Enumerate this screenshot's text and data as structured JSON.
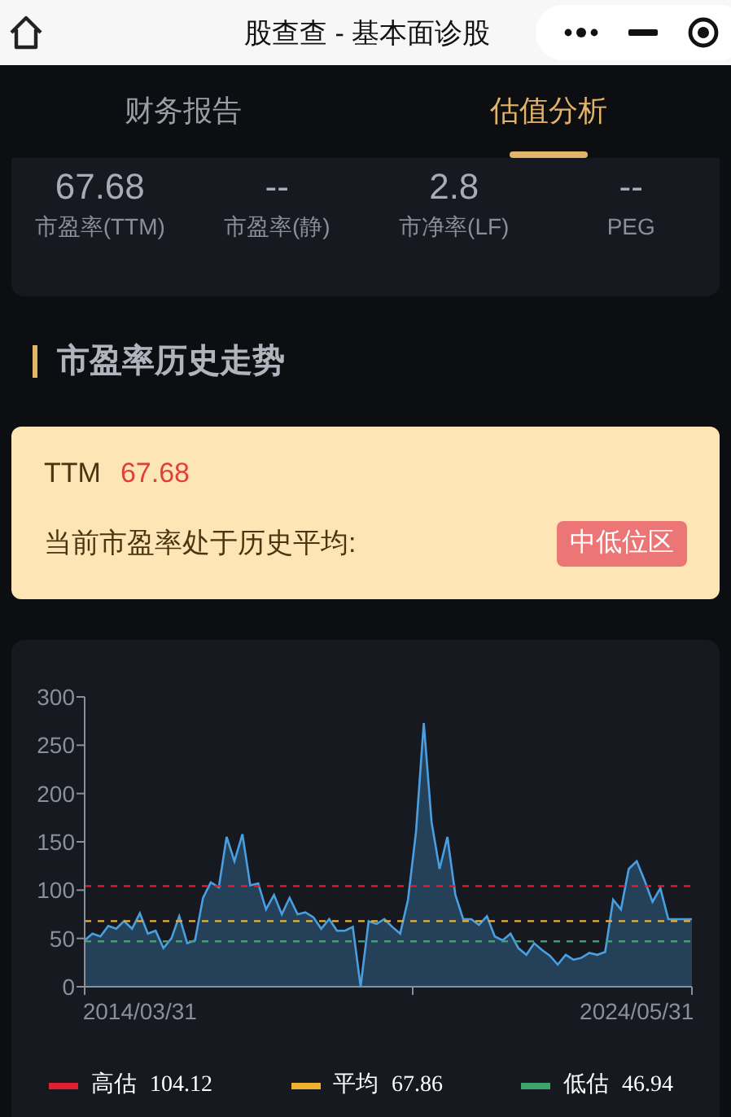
{
  "window": {
    "title": "股查查 - 基本面诊股"
  },
  "tabs": [
    {
      "label": "财务报告",
      "selected": false
    },
    {
      "label": "估值分析",
      "selected": true
    }
  ],
  "metrics": [
    {
      "value": "67.68",
      "label": "市盈率(TTM)"
    },
    {
      "value": "--",
      "label": "市盈率(静)"
    },
    {
      "value": "2.8",
      "label": "市净率(LF)"
    },
    {
      "value": "--",
      "label": "PEG"
    }
  ],
  "section_title": "市盈率历史走势",
  "summary": {
    "label": "TTM",
    "value": "67.68",
    "text": "当前市盈率处于历史平均:",
    "badge": "中低位区"
  },
  "chart_data": {
    "type": "area",
    "ylim": [
      0,
      300
    ],
    "yticks": [
      0,
      50,
      100,
      150,
      200,
      250,
      300
    ],
    "categories": [
      null,
      null,
      null,
      null,
      null,
      null,
      null,
      "2014/03/31",
      null,
      null,
      null,
      null,
      null,
      null,
      null,
      null,
      null,
      null,
      null,
      null,
      null,
      null,
      null,
      null,
      null,
      null,
      null,
      null,
      null,
      null,
      null,
      null,
      null,
      null,
      null,
      null,
      null,
      null,
      null,
      null,
      null,
      null,
      null,
      null,
      null,
      null,
      null,
      null,
      null,
      null,
      null,
      null,
      null,
      null,
      null,
      null,
      null,
      null,
      null,
      null,
      null,
      null,
      null,
      null,
      null,
      null,
      null,
      null,
      null,
      null,
      "2024/05/31",
      null,
      null,
      null,
      null,
      null,
      null,
      null
    ],
    "series": [
      {
        "color": "#4a9fe0",
        "values": [
          48,
          55,
          52,
          63,
          60,
          68,
          60,
          76,
          55,
          58,
          40,
          50,
          73,
          45,
          48,
          92,
          108,
          103,
          155,
          130,
          158,
          105,
          107,
          80,
          95,
          75,
          92,
          75,
          77,
          72,
          60,
          70,
          58,
          58,
          62,
          0,
          68,
          65,
          70,
          62,
          55,
          90,
          160,
          273,
          170,
          122,
          155,
          95,
          70,
          70,
          64,
          73,
          52,
          48,
          55,
          40,
          33,
          45,
          38,
          32,
          23,
          33,
          28,
          30,
          35,
          33,
          36,
          90,
          80,
          122,
          130,
          110,
          88,
          102,
          70,
          70,
          70,
          70
        ]
      },
      {
        "name": "高估",
        "type": "line",
        "line_style": "dashed",
        "color": "#e0202e",
        "values": [
          104.12,
          104.12,
          104.12,
          104.12,
          104.12,
          104.12,
          104.12,
          104.12,
          104.12,
          104.12,
          104.12,
          104.12,
          104.12,
          104.12,
          104.12,
          104.12,
          104.12,
          104.12,
          104.12,
          104.12,
          104.12,
          104.12,
          104.12,
          104.12,
          104.12,
          104.12,
          104.12,
          104.12,
          104.12,
          104.12,
          104.12,
          104.12,
          104.12,
          104.12,
          104.12,
          104.12,
          104.12,
          104.12,
          104.12,
          104.12,
          104.12,
          104.12,
          104.12,
          104.12,
          104.12,
          104.12,
          104.12,
          104.12,
          104.12,
          104.12,
          104.12,
          104.12,
          104.12,
          104.12,
          104.12,
          104.12,
          104.12,
          104.12,
          104.12,
          104.12,
          104.12,
          104.12,
          104.12,
          104.12,
          104.12,
          104.12,
          104.12,
          104.12,
          104.12,
          104.12,
          104.12,
          104.12,
          104.12,
          104.12,
          104.12,
          104.12,
          104.12,
          104.12
        ]
      },
      {
        "name": "平均",
        "type": "line",
        "line_style": "dashed",
        "color": "#f0b030",
        "values": [
          67.86,
          67.86,
          67.86,
          67.86,
          67.86,
          67.86,
          67.86,
          67.86,
          67.86,
          67.86,
          67.86,
          67.86,
          67.86,
          67.86,
          67.86,
          67.86,
          67.86,
          67.86,
          67.86,
          67.86,
          67.86,
          67.86,
          67.86,
          67.86,
          67.86,
          67.86,
          67.86,
          67.86,
          67.86,
          67.86,
          67.86,
          67.86,
          67.86,
          67.86,
          67.86,
          67.86,
          67.86,
          67.86,
          67.86,
          67.86,
          67.86,
          67.86,
          67.86,
          67.86,
          67.86,
          67.86,
          67.86,
          67.86,
          67.86,
          67.86,
          67.86,
          67.86,
          67.86,
          67.86,
          67.86,
          67.86,
          67.86,
          67.86,
          67.86,
          67.86,
          67.86,
          67.86,
          67.86,
          67.86,
          67.86,
          67.86,
          67.86,
          67.86,
          67.86,
          67.86,
          67.86,
          67.86,
          67.86,
          67.86,
          67.86,
          67.86,
          67.86,
          67.86
        ]
      },
      {
        "name": "低估",
        "type": "line",
        "line_style": "dashed",
        "color": "#3aa46a",
        "values": [
          46.94,
          46.94,
          46.94,
          46.94,
          46.94,
          46.94,
          46.94,
          46.94,
          46.94,
          46.94,
          46.94,
          46.94,
          46.94,
          46.94,
          46.94,
          46.94,
          46.94,
          46.94,
          46.94,
          46.94,
          46.94,
          46.94,
          46.94,
          46.94,
          46.94,
          46.94,
          46.94,
          46.94,
          46.94,
          46.94,
          46.94,
          46.94,
          46.94,
          46.94,
          46.94,
          46.94,
          46.94,
          46.94,
          46.94,
          46.94,
          46.94,
          46.94,
          46.94,
          46.94,
          46.94,
          46.94,
          46.94,
          46.94,
          46.94,
          46.94,
          46.94,
          46.94,
          46.94,
          46.94,
          46.94,
          46.94,
          46.94,
          46.94,
          46.94,
          46.94,
          46.94,
          46.94,
          46.94,
          46.94,
          46.94,
          46.94,
          46.94,
          46.94,
          46.94,
          46.94,
          46.94,
          46.94,
          46.94,
          46.94,
          46.94,
          46.94,
          46.94,
          46.94
        ]
      }
    ]
  },
  "legend_values": [
    "104.12",
    "67.86",
    "46.94"
  ]
}
